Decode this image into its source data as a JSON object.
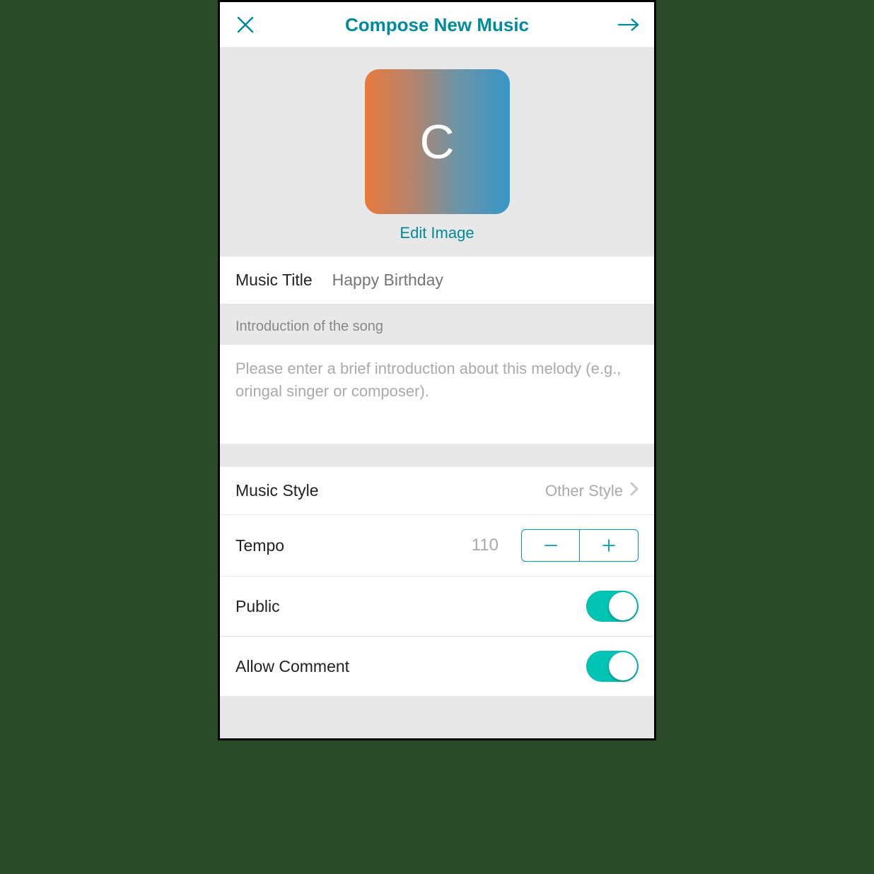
{
  "header": {
    "title": "Compose New Music"
  },
  "image_section": {
    "avatar_letter": "C",
    "edit_label": "Edit Image"
  },
  "form": {
    "title_label": "Music Title",
    "title_placeholder": "Happy Birthday",
    "intro_header": "Introduction of the song",
    "intro_placeholder": "Please enter a brief introduction about this melody (e.g., oringal singer or composer).",
    "style_label": "Music Style",
    "style_value": "Other Style",
    "tempo_label": "Tempo",
    "tempo_value": "110",
    "public_label": "Public",
    "allow_comment_label": "Allow Comment",
    "public_on": true,
    "allow_comment_on": true
  },
  "colors": {
    "accent": "#008b9a",
    "switch": "#00c4b4"
  }
}
